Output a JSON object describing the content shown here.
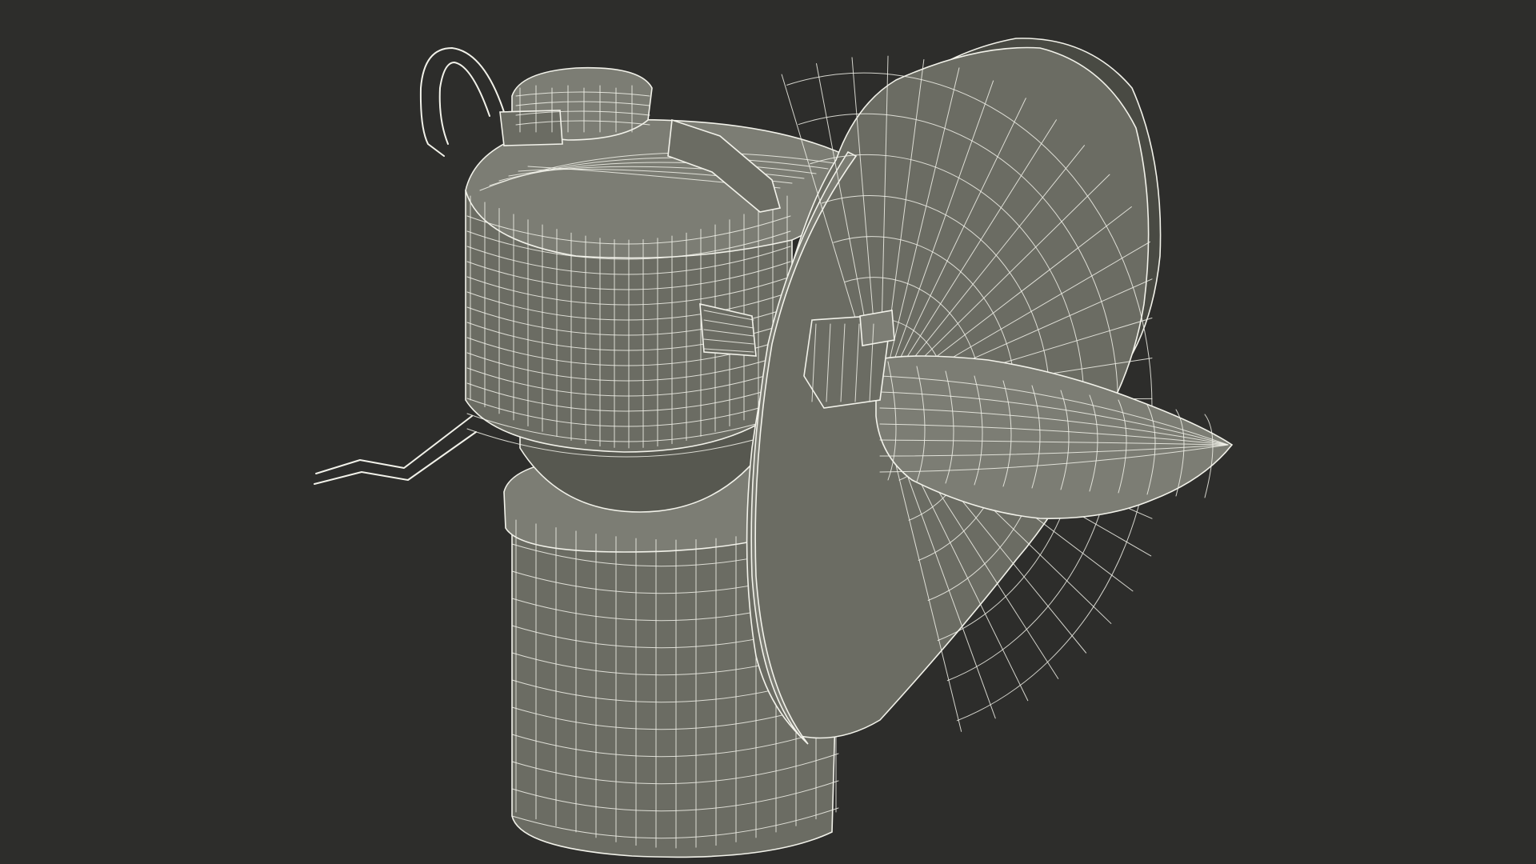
{
  "scene": {
    "subject": "carbide-miners-lamp-wireframe-render",
    "colors": {
      "background": "#2d2d2b",
      "surface_light": "#7c7d74",
      "surface_mid": "#6b6c63",
      "surface_dark": "#575850",
      "surface_shadow": "#494a43",
      "wire": "#f2f2ea"
    }
  }
}
